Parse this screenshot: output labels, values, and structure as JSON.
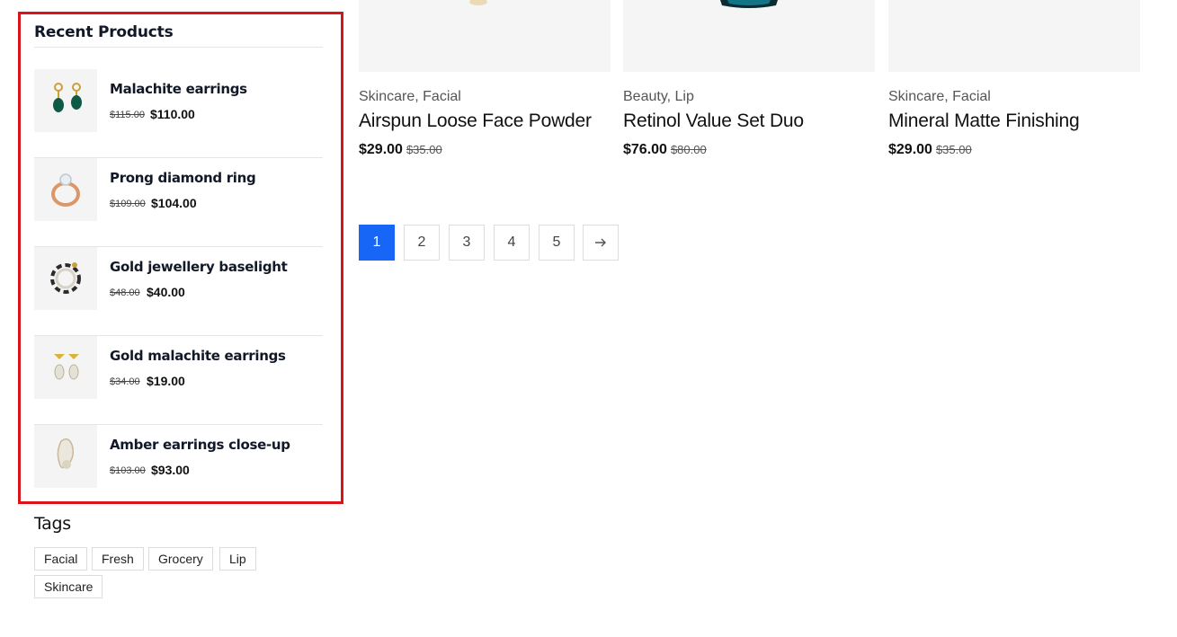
{
  "recent_products": {
    "title": "Recent Products",
    "items": [
      {
        "name": "Malachite earrings",
        "old_price": "$115.00",
        "new_price": "$110.00",
        "icon": "malachite-earrings-image"
      },
      {
        "name": "Prong diamond ring",
        "old_price": "$109.00",
        "new_price": "$104.00",
        "icon": "diamond-ring-image"
      },
      {
        "name": "Gold jewellery baselight",
        "old_price": "$48.00",
        "new_price": "$40.00",
        "icon": "gold-jewellery-image"
      },
      {
        "name": "Gold malachite earrings",
        "old_price": "$34.00",
        "new_price": "$19.00",
        "icon": "gold-malachite-earrings-image"
      },
      {
        "name": "Amber earrings close-up",
        "old_price": "$103.00",
        "new_price": "$93.00",
        "icon": "amber-earrings-image"
      }
    ]
  },
  "tags": {
    "title": "Tags",
    "items": [
      "Facial",
      "Fresh",
      "Grocery",
      "Lip",
      "Skincare"
    ]
  },
  "products": [
    {
      "category": "Skincare, Facial",
      "title": "Airspun Loose Face Powder",
      "price": "$29.00",
      "old_price": "$35.00"
    },
    {
      "category": "Beauty, Lip",
      "title": "Retinol Value Set Duo",
      "price": "$76.00",
      "old_price": "$80.00"
    },
    {
      "category": "Skincare, Facial",
      "title": "Mineral Matte Finishing",
      "price": "$29.00",
      "old_price": "$35.00"
    }
  ],
  "pagination": {
    "pages": [
      "1",
      "2",
      "3",
      "4",
      "5"
    ],
    "current": "1",
    "next_icon": "arrow-right-icon"
  },
  "colors": {
    "highlight_border": "#d9141b",
    "accent": "#1766f5"
  }
}
